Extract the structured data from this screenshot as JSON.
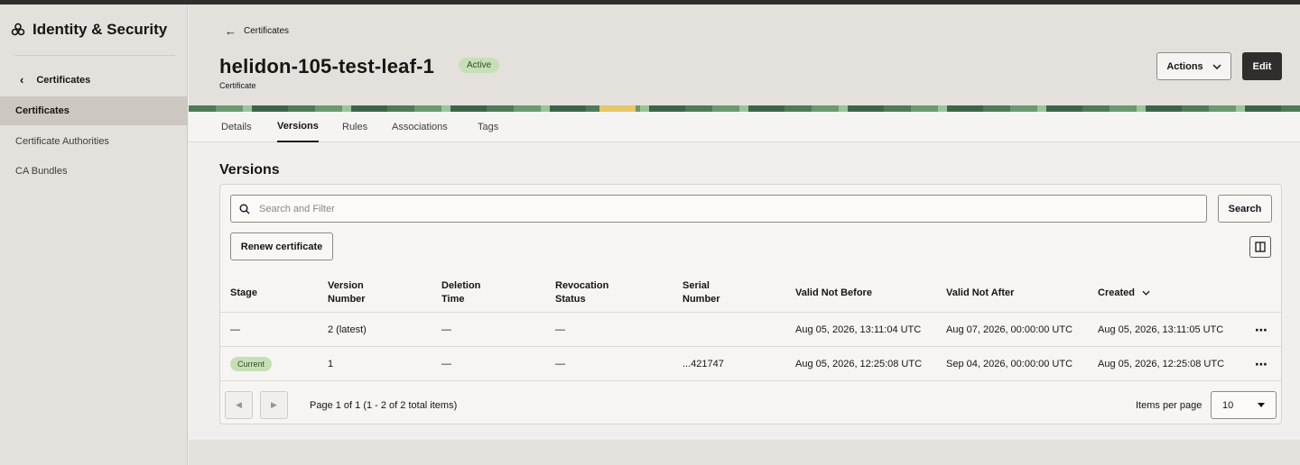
{
  "sidebar": {
    "brand_title": "Identity & Security",
    "back_label": "Certificates",
    "items": [
      {
        "label": "Certificates",
        "active": true
      },
      {
        "label": "Certificate Authorities",
        "active": false
      },
      {
        "label": "CA Bundles",
        "active": false
      }
    ]
  },
  "header": {
    "back_label": "Certificates",
    "title": "helidon-105-test-leaf-1",
    "status": "Active",
    "subtitle": "Certificate",
    "actions_label": "Actions",
    "edit_label": "Edit"
  },
  "tabs": [
    {
      "label": "Details",
      "active": false
    },
    {
      "label": "Versions",
      "active": true
    },
    {
      "label": "Rules",
      "active": false
    },
    {
      "label": "Associations",
      "active": false
    },
    {
      "label": "Tags",
      "active": false
    }
  ],
  "versions": {
    "title": "Versions",
    "search_placeholder": "Search and Filter",
    "search_button": "Search",
    "renew_button": "Renew certificate",
    "columns": [
      {
        "line1": "Stage",
        "line2": ""
      },
      {
        "line1": "Version",
        "line2": "Number"
      },
      {
        "line1": "Deletion",
        "line2": "Time"
      },
      {
        "line1": "Revocation",
        "line2": "Status"
      },
      {
        "line1": "Serial",
        "line2": "Number"
      },
      {
        "line1": "Valid Not Before",
        "line2": ""
      },
      {
        "line1": "Valid Not After",
        "line2": ""
      },
      {
        "line1": "Created",
        "line2": ""
      }
    ],
    "rows": [
      {
        "stage": "—",
        "version": "2 (latest)",
        "deletion_time": "—",
        "revocation_status": "—",
        "serial": "",
        "valid_not_before": "Aug 05, 2026, 13:11:04 UTC",
        "valid_not_after": "Aug 07, 2026, 00:00:00 UTC",
        "created": "Aug 05, 2026, 13:11:05 UTC"
      },
      {
        "stage": "Current",
        "version": "1",
        "deletion_time": "—",
        "revocation_status": "—",
        "serial": "...421747",
        "valid_not_before": "Aug 05, 2026, 12:25:08 UTC",
        "valid_not_after": "Sep 04, 2026, 00:00:00 UTC",
        "created": "Aug 05, 2026, 12:25:08 UTC"
      }
    ],
    "pager": {
      "text": "Page 1 of 1 (1 - 2 of 2 total items)",
      "items_per_page_label": "Items per page",
      "items_per_page_value": "10"
    }
  },
  "colors": {
    "badge_green": "#c7dfb6",
    "dark_button": "#312d2a",
    "sidebar_bg": "#e4e1dd"
  }
}
